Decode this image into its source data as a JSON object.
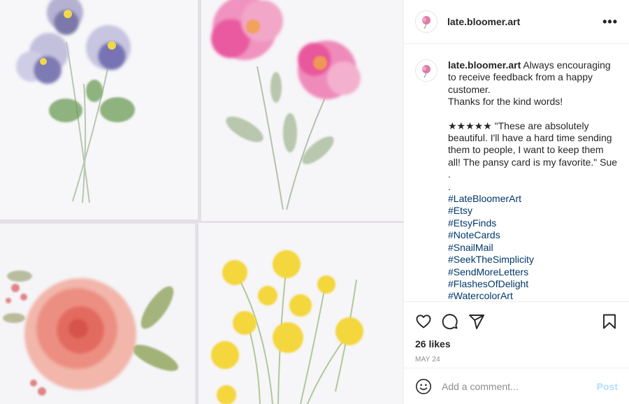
{
  "account": {
    "username": "late.bloomer.art"
  },
  "caption": {
    "username": "late.bloomer.art",
    "lines": [
      "Always encouraging to receive feedback from a happy customer.",
      "Thanks for the kind words!"
    ],
    "review": "★★★★★ \"These are absolutely beautiful. I'll have a hard time sending them to people, I want to keep them all! The pansy card is my favorite.\" Sue",
    "dots": [
      ".",
      "."
    ],
    "hashtags": [
      "#LateBloomerArt",
      "#Etsy",
      "#EtsyFinds",
      "#NoteCards",
      "#SnailMail",
      "#SeekTheSimplicity",
      "#SendMoreLetters",
      "#FlashesOfDelight",
      "#WatercolorArt"
    ]
  },
  "stats": {
    "likes": "26 likes",
    "date": "MAY 24"
  },
  "comment_box": {
    "placeholder": "Add a comment...",
    "post_label": "Post"
  },
  "colors": {
    "link": "#00376b",
    "post_disabled": "#b2dffc",
    "muted": "#8e8e8e"
  },
  "icons": [
    "more-options-icon",
    "heart-icon",
    "comment-icon",
    "share-icon",
    "bookmark-icon",
    "emoji-icon"
  ]
}
